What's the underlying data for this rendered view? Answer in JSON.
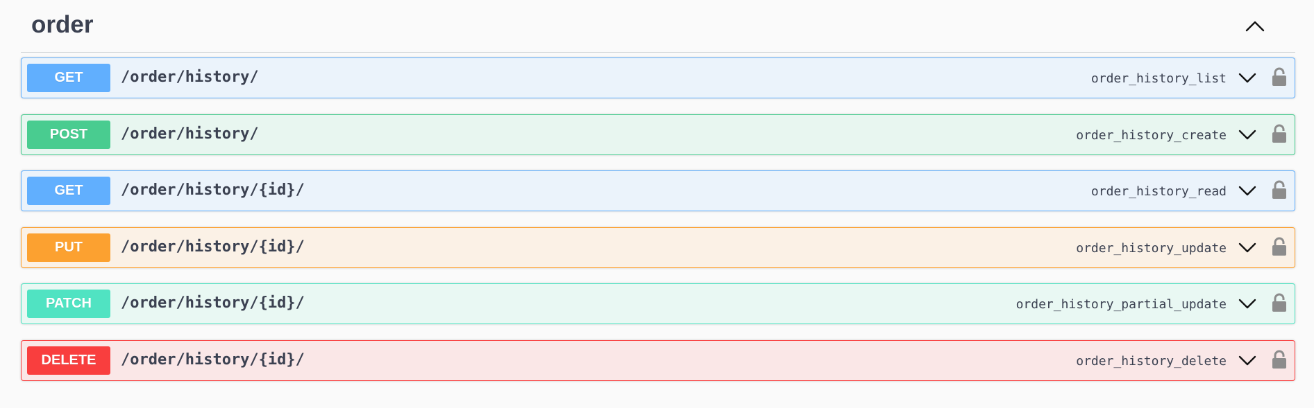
{
  "tag": {
    "title": "order",
    "toggle_icon": "chevron-up-icon"
  },
  "operations": [
    {
      "method": "GET",
      "path": "/order/history/",
      "operation_id": "order_history_list",
      "color": "#61affe"
    },
    {
      "method": "POST",
      "path": "/order/history/",
      "operation_id": "order_history_create",
      "color": "#49cc90"
    },
    {
      "method": "GET",
      "path": "/order/history/{id}/",
      "operation_id": "order_history_read",
      "color": "#61affe"
    },
    {
      "method": "PUT",
      "path": "/order/history/{id}/",
      "operation_id": "order_history_update",
      "color": "#fca130"
    },
    {
      "method": "PATCH",
      "path": "/order/history/{id}/",
      "operation_id": "order_history_partial_update",
      "color": "#50e3c2"
    },
    {
      "method": "DELETE",
      "path": "/order/history/{id}/",
      "operation_id": "order_history_delete",
      "color": "#f93e3e"
    }
  ],
  "icons": {
    "expand": "chevron-down-icon",
    "auth": "lock-icon"
  }
}
